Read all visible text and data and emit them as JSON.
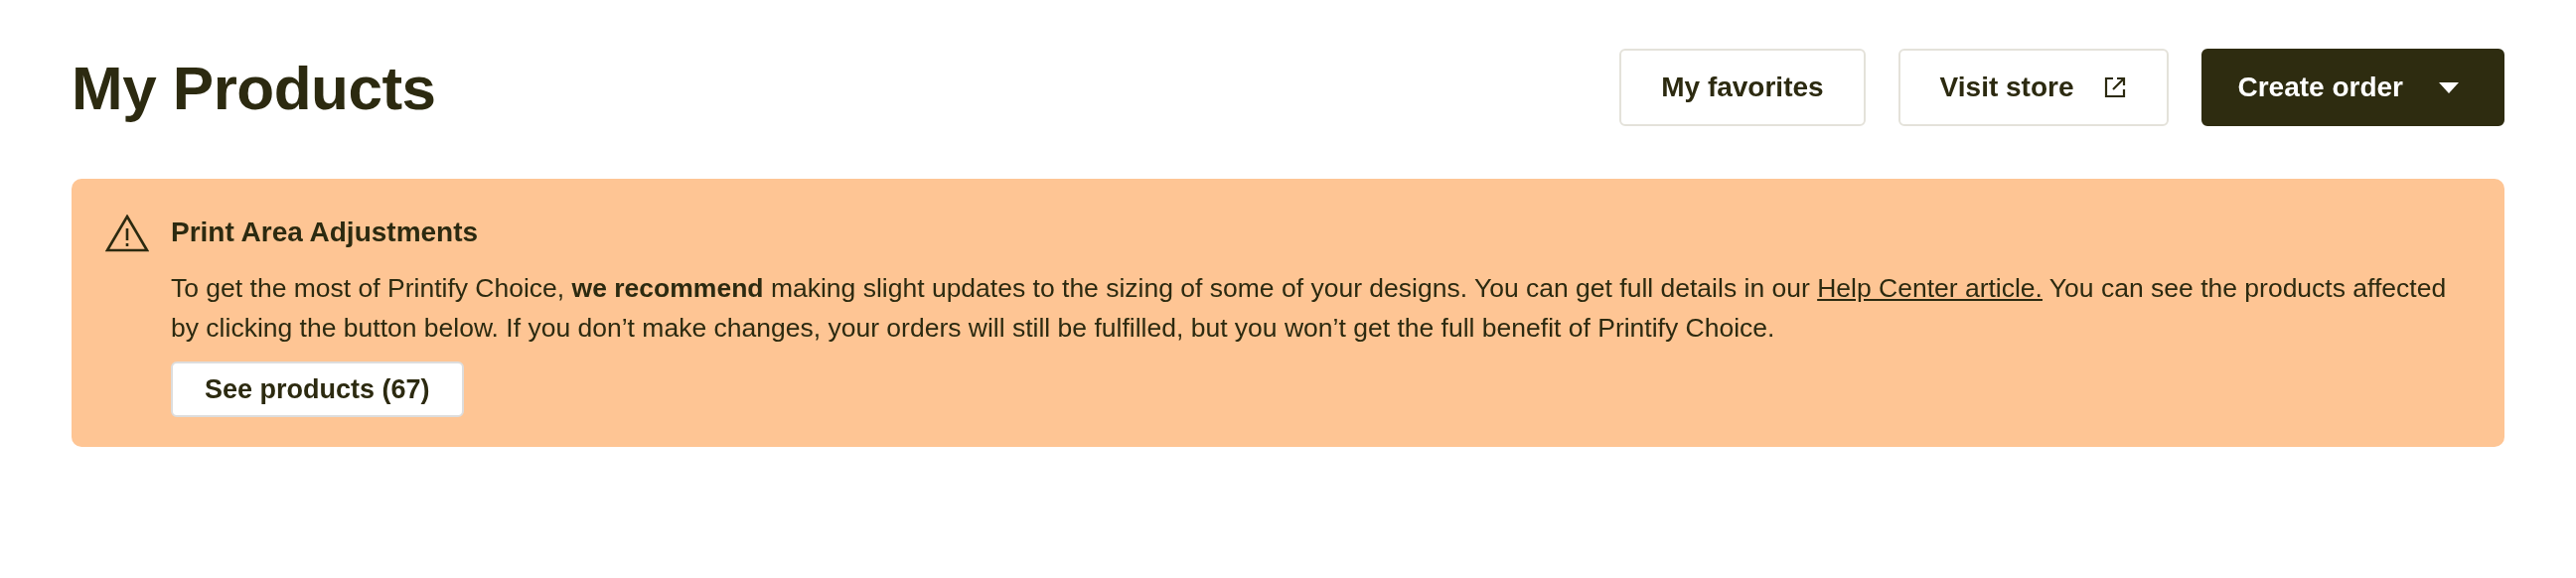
{
  "page": {
    "title": "My Products"
  },
  "actions": [
    {
      "label": "My favorites",
      "kind": "plain"
    },
    {
      "label": "Visit store",
      "kind": "external"
    },
    {
      "label": "Create order",
      "kind": "dropdown"
    }
  ],
  "banner": {
    "title": "Print Area Adjustments",
    "body_before": "To get the most of Printify Choice, **we recommend** making slight updates to the sizing of some of your designs. You can get full details in our",
    "link": "Help Center article.",
    "body_after": "You can see the products affected by clicking the button below. If you don’t make changes, your orders will still be fulfilled, but you won’t get the full benefit of Printify Choice.",
    "button": "See products (67)"
  }
}
